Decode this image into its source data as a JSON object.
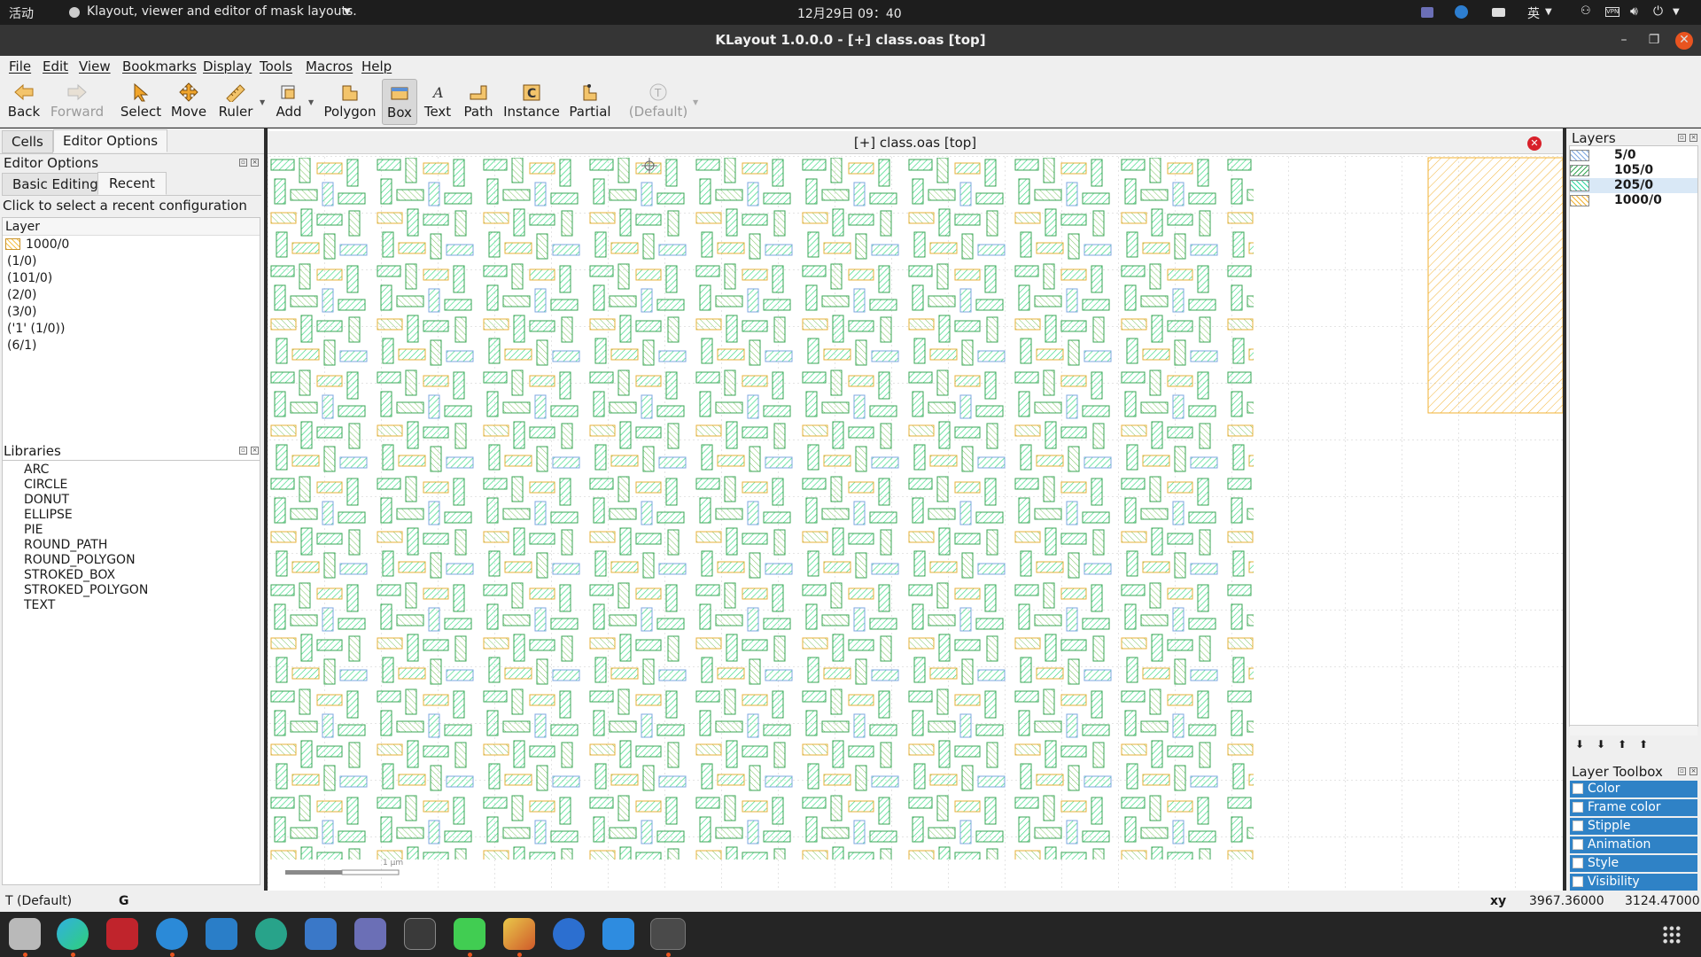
{
  "system_bar": {
    "activities": "活动",
    "app_menu": "Klayout, viewer and editor of mask layouts.",
    "clock": "12月29日  09：40",
    "input_method": "英"
  },
  "window": {
    "title": "KLayout 1.0.0.0 - [+] class.oas [top]"
  },
  "menu": [
    "File",
    "Edit",
    "View",
    "Bookmarks",
    "Display",
    "Tools",
    "Macros",
    "Help"
  ],
  "toolbar": {
    "back": "Back",
    "forward": "Forward",
    "select": "Select",
    "move": "Move",
    "ruler": "Ruler",
    "add": "Add",
    "polygon": "Polygon",
    "box": "Box",
    "text": "Text",
    "path": "Path",
    "instance": "Instance",
    "partial": "Partial",
    "default": "(Default)"
  },
  "left_panel": {
    "tabs": [
      "Cells",
      "Editor Options"
    ],
    "editor_options_title": "Editor Options",
    "subtabs": [
      "Basic Editing",
      "Recent"
    ],
    "hint": "Click to select a recent configuration",
    "layer_header": "Layer",
    "recent_layers": [
      "1000/0",
      "(1/0)",
      "(101/0)",
      "(2/0)",
      "(3/0)",
      "('1' (1/0))",
      "(6/1)"
    ],
    "libraries_title": "Libraries",
    "libraries": [
      "ARC",
      "CIRCLE",
      "DONUT",
      "ELLIPSE",
      "PIE",
      "ROUND_PATH",
      "ROUND_POLYGON",
      "STROKED_BOX",
      "STROKED_POLYGON",
      "TEXT"
    ]
  },
  "canvas": {
    "title": "[+] class.oas [top]",
    "scale_label": "1 µm"
  },
  "right_panel": {
    "layers_title": "Layers",
    "layers": [
      {
        "name": "5/0",
        "color": "#7ea7e0"
      },
      {
        "name": "105/0",
        "color": "#3aa655"
      },
      {
        "name": "205/0",
        "color": "#2fd6a0"
      },
      {
        "name": "1000/0",
        "color": "#f2b233"
      }
    ],
    "toolbox_title": "Layer Toolbox",
    "toolbox_items": [
      "Color",
      "Frame color",
      "Stipple",
      "Animation",
      "Style",
      "Visibility"
    ]
  },
  "status": {
    "mode": "T (Default)",
    "grid": "G",
    "xy_label": "xy",
    "x": "3967.36000",
    "y": "3124.47000"
  },
  "dock_apps": [
    "files-icon",
    "edge-icon",
    "app-red-icon",
    "browser-icon",
    "vscode-icon",
    "app-circle-icon",
    "text-editor-icon",
    "cat-icon",
    "monitor-icon",
    "qt-creator-icon",
    "paint-icon",
    "thunderbird-icon",
    "store-icon",
    "klayout-icon"
  ]
}
